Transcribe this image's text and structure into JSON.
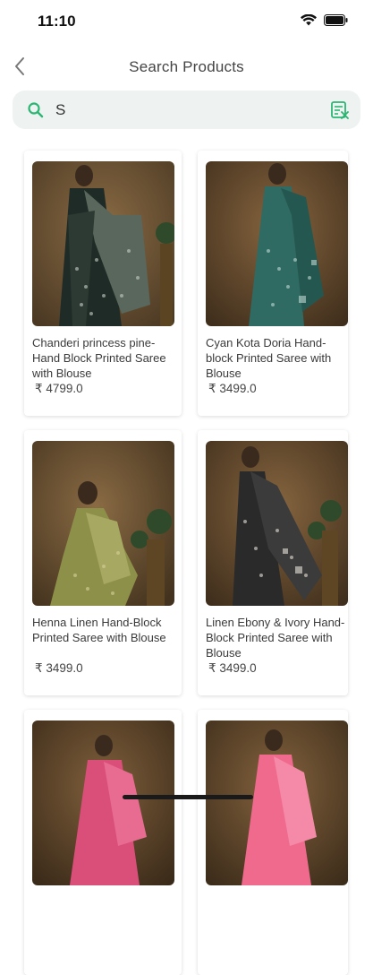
{
  "status_bar": {
    "time": "11:10"
  },
  "header": {
    "title": "Search Products"
  },
  "search": {
    "value": "S"
  },
  "products": [
    {
      "name": "Chanderi princess pine-Hand Block Printed Saree with Blouse",
      "price": "₹ 4799.0"
    },
    {
      "name": "Cyan Kota Doria Hand-block Printed Saree with Blouse",
      "price": "₹ 3499.0"
    },
    {
      "name": "Henna Linen Hand-Block Printed Saree with Blouse",
      "price": "₹ 3499.0"
    },
    {
      "name": "Linen Ebony & Ivory Hand-Block Printed Saree with Blouse",
      "price": "₹ 3499.0"
    },
    {
      "name": "",
      "price": ""
    },
    {
      "name": "",
      "price": ""
    }
  ],
  "colors": {
    "accent": "#2bb673",
    "search_bg": "#eef2f1"
  }
}
